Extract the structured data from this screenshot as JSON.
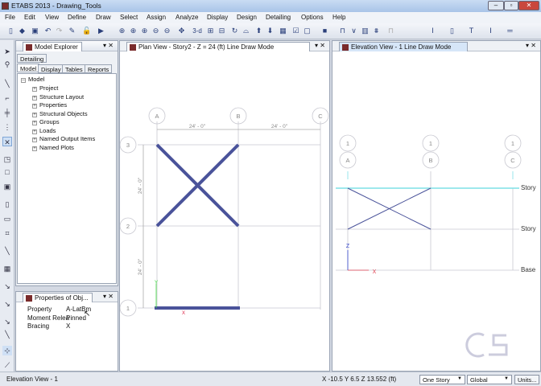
{
  "window": {
    "title": "ETABS 2013  - Drawing_Tools",
    "minimize": "–",
    "maximize": "▫",
    "close": "✕"
  },
  "menu": [
    "File",
    "Edit",
    "View",
    "Define",
    "Draw",
    "Select",
    "Assign",
    "Analyze",
    "Display",
    "Design",
    "Detailing",
    "Options",
    "Help"
  ],
  "toolbar": {
    "three_d": "3-d"
  },
  "explorer": {
    "title": "Model Explorer",
    "tabs_top": [
      "Detailing"
    ],
    "tabs": [
      "Model",
      "Display",
      "Tables",
      "Reports"
    ],
    "active_tab": "Model",
    "root": "Model",
    "items": [
      "Project",
      "Structure Layout",
      "Properties",
      "Structural Objects",
      "Groups",
      "Loads",
      "Named Output Items",
      "Named Plots"
    ]
  },
  "properties": {
    "title": "Properties of Obj...",
    "rows": [
      {
        "label": "Property",
        "value": "A-LatBm"
      },
      {
        "label": "Moment Relea",
        "value": "Pinned"
      },
      {
        "label": "Bracing",
        "value": "X"
      }
    ]
  },
  "plan_view": {
    "title": "Plan View - Story2 - Z = 24 (ft)  Line Draw Mode",
    "grid_x": [
      "A",
      "B",
      "C"
    ],
    "grid_y": [
      "3",
      "2",
      "1"
    ],
    "dim_x": [
      "24' - 0\"",
      "24' - 0\""
    ],
    "dim_y": [
      "24' - 0\"",
      "24' - 0\""
    ],
    "axis_y": "Y",
    "axis_x": "X"
  },
  "elevation_view": {
    "title": "Elevation View - 1  Line Draw Mode",
    "grid_top": [
      "1",
      "1",
      "1"
    ],
    "grid_x": [
      "A",
      "B",
      "C"
    ],
    "stories": [
      "Story",
      "Story",
      "Base"
    ],
    "axis_z": "Z",
    "axis_x": "X"
  },
  "status": {
    "view": "Elevation View - 1",
    "coords": "X -10.5  Y 6.5  Z 13.552 (ft)",
    "story_select": "One Story",
    "coord_select": "Global",
    "units_button": "Units..."
  },
  "colors": {
    "frame": "#4a539a",
    "cyan": "#7ee0e6",
    "grid": "#c8c8d0"
  }
}
